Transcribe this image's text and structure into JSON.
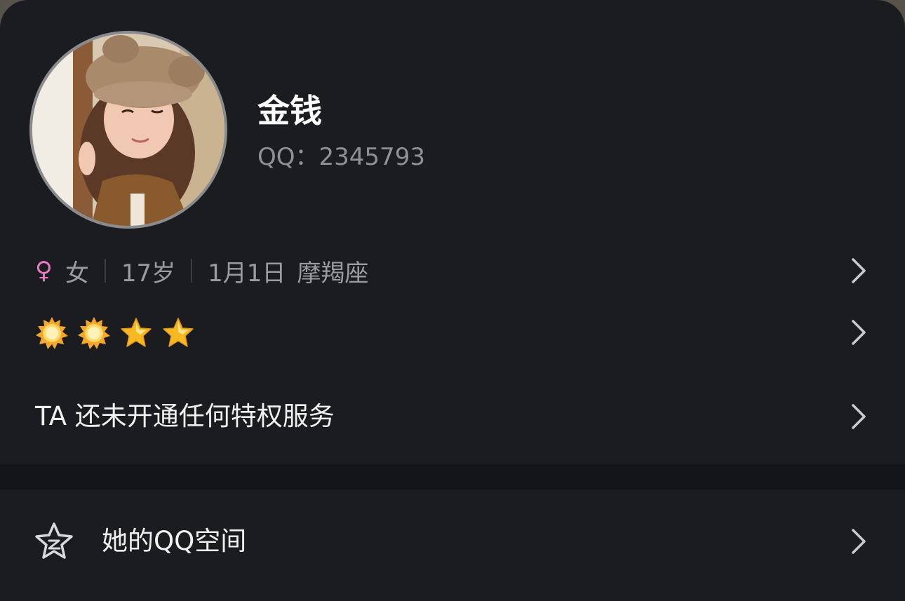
{
  "profile": {
    "name": "金钱",
    "qq_label": "QQ：",
    "qq_number": "2345793",
    "avatar_icon": "user-avatar-photo"
  },
  "info": {
    "gender_icon": "♀",
    "gender": "女",
    "age": "17岁",
    "birthday": "1月1日",
    "zodiac": "摩羯座"
  },
  "level": {
    "icons": [
      "sun-icon",
      "sun-icon",
      "star-icon",
      "star-icon"
    ]
  },
  "privilege": {
    "text": "TA 还未开通任何特权服务"
  },
  "space": {
    "label": "她的QQ空间",
    "icon": "qzone-star-icon"
  },
  "colors": {
    "background": "#1a1c20",
    "divider": "#121417",
    "gender_pink": "#e879c7",
    "secondary_text": "#9a9ca1"
  }
}
